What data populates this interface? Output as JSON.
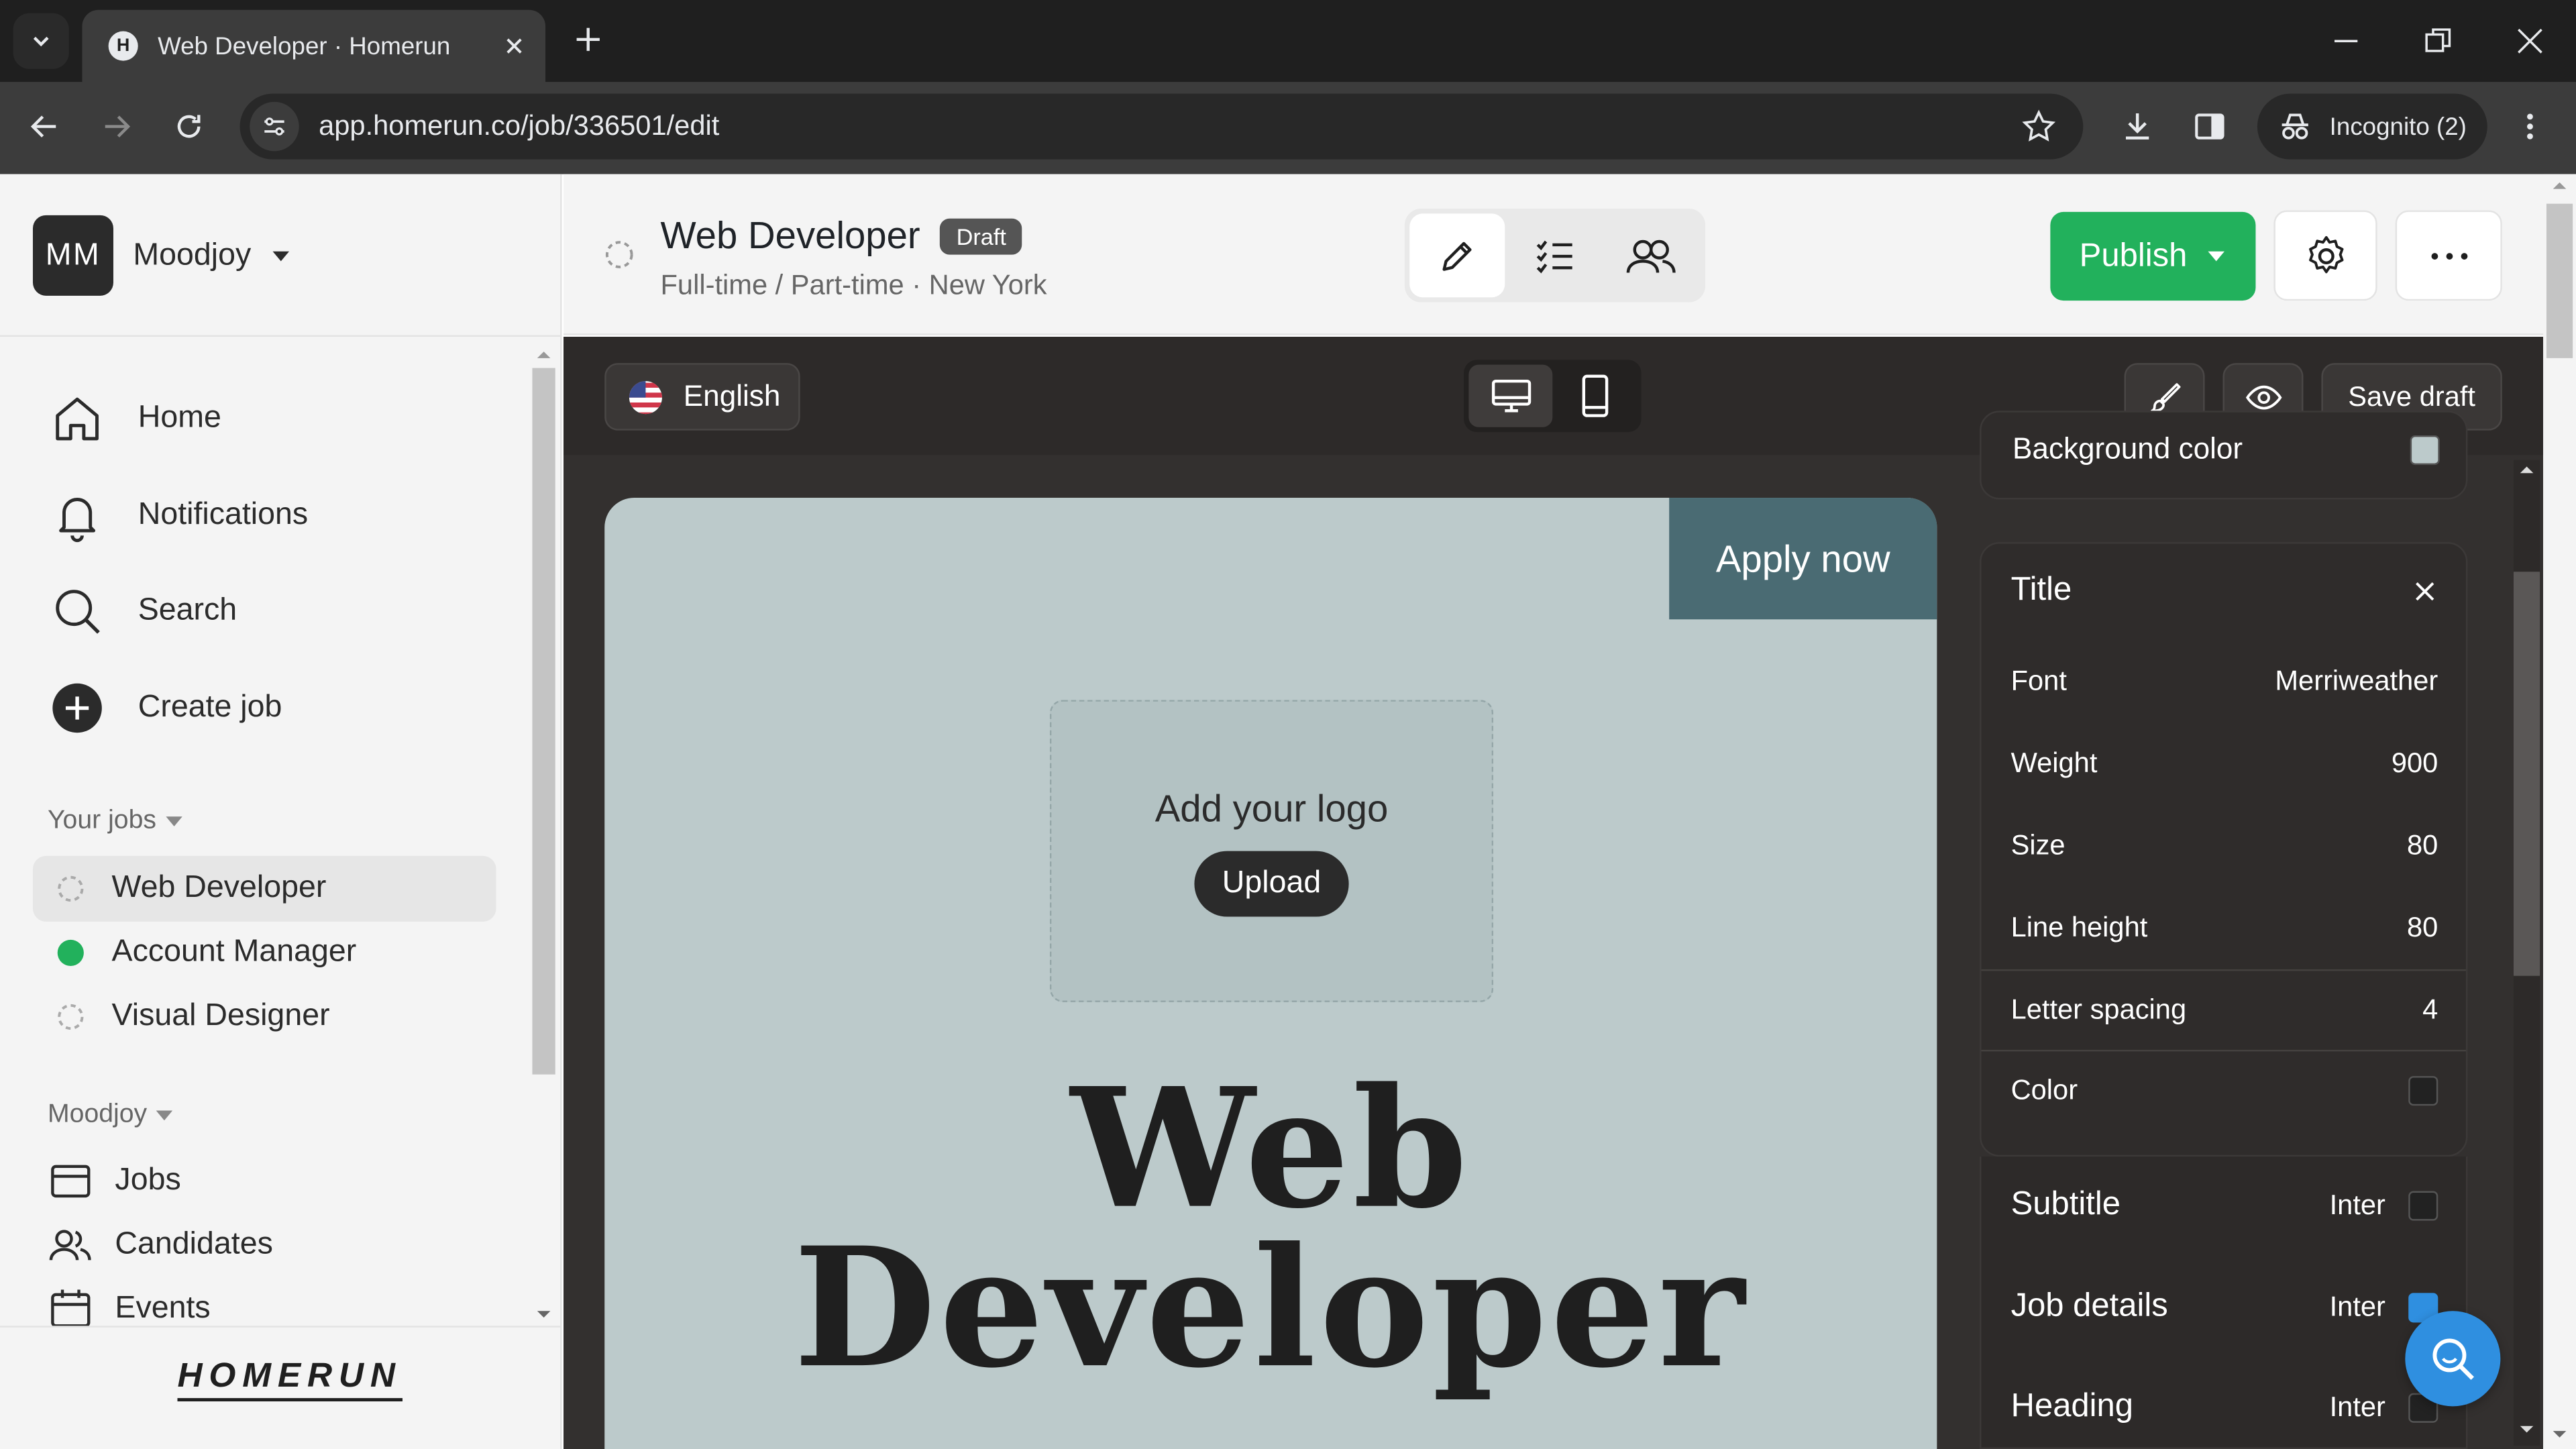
{
  "browser": {
    "tab_title": "Web Developer · Homerun",
    "url": "app.homerun.co/job/336501/edit",
    "incognito_label": "Incognito (2)"
  },
  "workspace": {
    "initials": "MM",
    "name": "Moodjoy"
  },
  "nav": [
    {
      "label": "Home",
      "icon": "home-icon"
    },
    {
      "label": "Notifications",
      "icon": "bell-icon"
    },
    {
      "label": "Search",
      "icon": "search-icon"
    },
    {
      "label": "Create job",
      "icon": "plus-circle-icon"
    }
  ],
  "your_jobs": {
    "heading": "Your jobs",
    "items": [
      {
        "label": "Web Developer",
        "status": "draft",
        "selected": true
      },
      {
        "label": "Account Manager",
        "status": "published",
        "selected": false
      },
      {
        "label": "Visual Designer",
        "status": "draft",
        "selected": false
      }
    ]
  },
  "org": {
    "heading": "Moodjoy",
    "items": [
      {
        "label": "Jobs",
        "icon": "jobs-icon"
      },
      {
        "label": "Candidates",
        "icon": "users-icon"
      },
      {
        "label": "Events",
        "icon": "calendar-icon"
      }
    ]
  },
  "brand": "HOMERUN",
  "job": {
    "title": "Web Developer",
    "badge": "Draft",
    "meta": "Full-time / Part-time · New York"
  },
  "toolbar": {
    "publish_label": "Publish",
    "save_draft_label": "Save draft",
    "language": "English"
  },
  "preview": {
    "apply_label": "Apply now",
    "logo_prompt": "Add your logo",
    "upload_label": "Upload",
    "title_line1": "Web",
    "title_line2": "Developer",
    "bg_color": "#bccacb",
    "apply_color": "#4a6b73"
  },
  "panel_top_label": "Background color",
  "title_panel": {
    "heading": "Title",
    "props": [
      {
        "label": "Font",
        "value": "Merriweather"
      },
      {
        "label": "Weight",
        "value": "900"
      },
      {
        "label": "Size",
        "value": "80"
      },
      {
        "label": "Line height",
        "value": "80"
      },
      {
        "label": "Letter spacing",
        "value": "4"
      },
      {
        "label": "Color",
        "value": ""
      }
    ]
  },
  "style_sections": [
    {
      "label": "Subtitle",
      "font": "Inter",
      "swatch": "#1f1f1f"
    },
    {
      "label": "Job details",
      "font": "Inter",
      "swatch": "#2f8fe0"
    },
    {
      "label": "Heading",
      "font": "Inter",
      "swatch": "#1f1f1f"
    }
  ],
  "colors": {
    "publish": "#22b15c",
    "accent_blue": "#2f8fe0"
  }
}
